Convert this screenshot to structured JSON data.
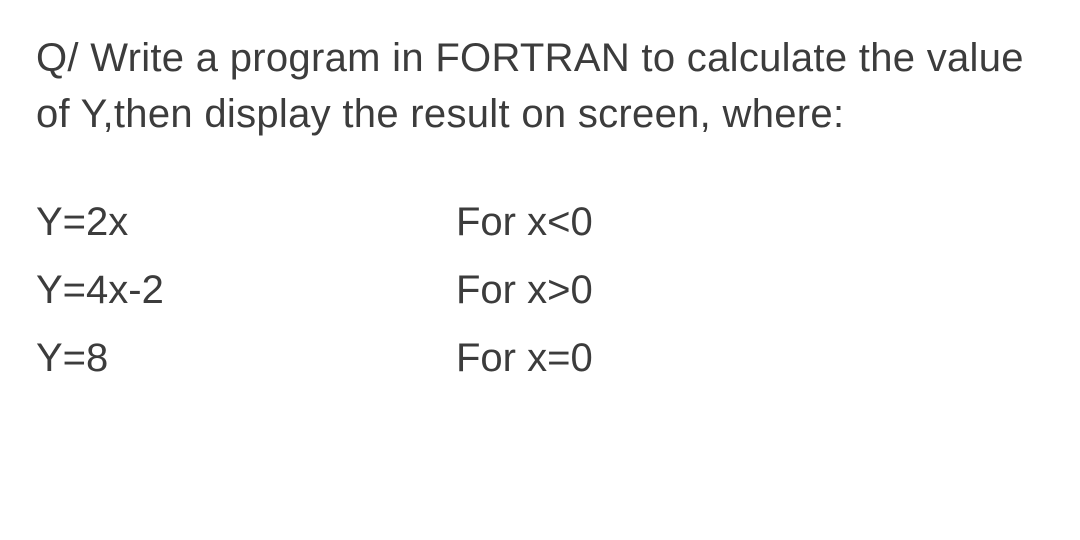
{
  "question": {
    "text": "Q/ Write a program in FORTRAN to calculate the value of Y,then display the result on screen, where:"
  },
  "equations": [
    {
      "expr": "Y=2x",
      "cond": "For x<0"
    },
    {
      "expr": "Y=4x-2",
      "cond": "For x>0"
    },
    {
      "expr": "Y=8",
      "cond": "For x=0"
    }
  ]
}
